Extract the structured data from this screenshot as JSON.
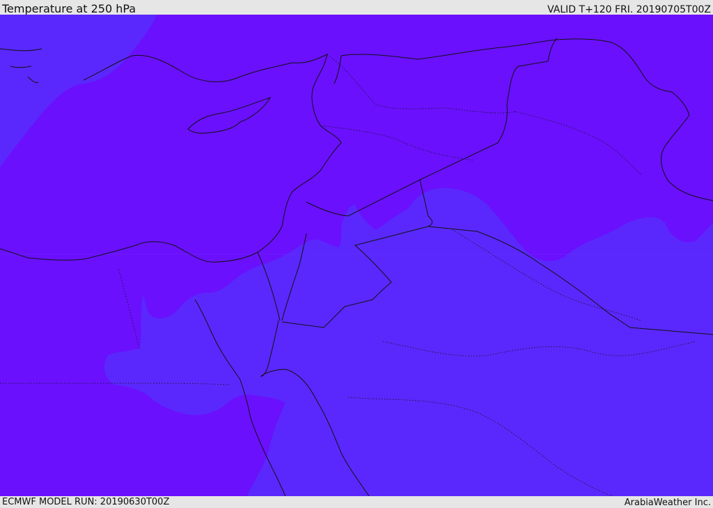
{
  "header": {
    "title": "Temperature at 250 hPa",
    "valid": "VALID T+120 FRI. 20190705T00Z"
  },
  "footer": {
    "model_run": "ECMWF MODEL RUN: 20190630T00Z",
    "credit": "ArabiaWeather Inc."
  },
  "map": {
    "field": "temperature",
    "level": "250 hPa",
    "colors": {
      "warm_band": "#6a10fd",
      "cool_band": "#5a28fc",
      "coast": "#111111",
      "border": "#111111"
    }
  }
}
